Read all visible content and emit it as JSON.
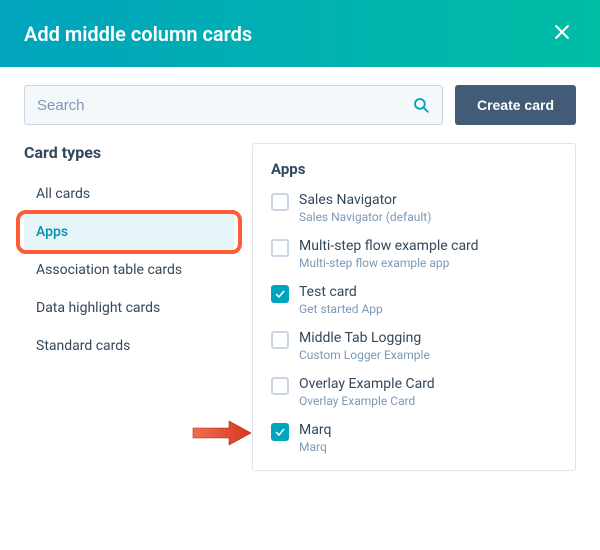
{
  "header": {
    "title": "Add middle column cards"
  },
  "search": {
    "placeholder": "Search"
  },
  "buttons": {
    "create_card": "Create card"
  },
  "sidebar": {
    "heading": "Card types",
    "items": [
      {
        "label": "All cards"
      },
      {
        "label": "Apps"
      },
      {
        "label": "Association table cards"
      },
      {
        "label": "Data highlight cards"
      },
      {
        "label": "Standard cards"
      }
    ],
    "selected_index": 1
  },
  "panel": {
    "heading": "Apps",
    "cards": [
      {
        "title": "Sales Navigator",
        "subtitle": "Sales Navigator (default)",
        "checked": false
      },
      {
        "title": "Multi-step flow example card",
        "subtitle": "Multi-step flow example app",
        "checked": false
      },
      {
        "title": "Test card",
        "subtitle": "Get started App",
        "checked": true
      },
      {
        "title": "Middle Tab Logging",
        "subtitle": "Custom Logger Example",
        "checked": false
      },
      {
        "title": "Overlay Example Card",
        "subtitle": "Overlay Example Card",
        "checked": false
      },
      {
        "title": "Marq",
        "subtitle": "Marq",
        "checked": true
      }
    ]
  },
  "annotations": {
    "highlight_sidebar_index": 1,
    "arrow_target_card_index": 5
  },
  "colors": {
    "accent": "#00a4bd",
    "highlight_border": "#ff5c35",
    "arrow": "#e2432a"
  }
}
